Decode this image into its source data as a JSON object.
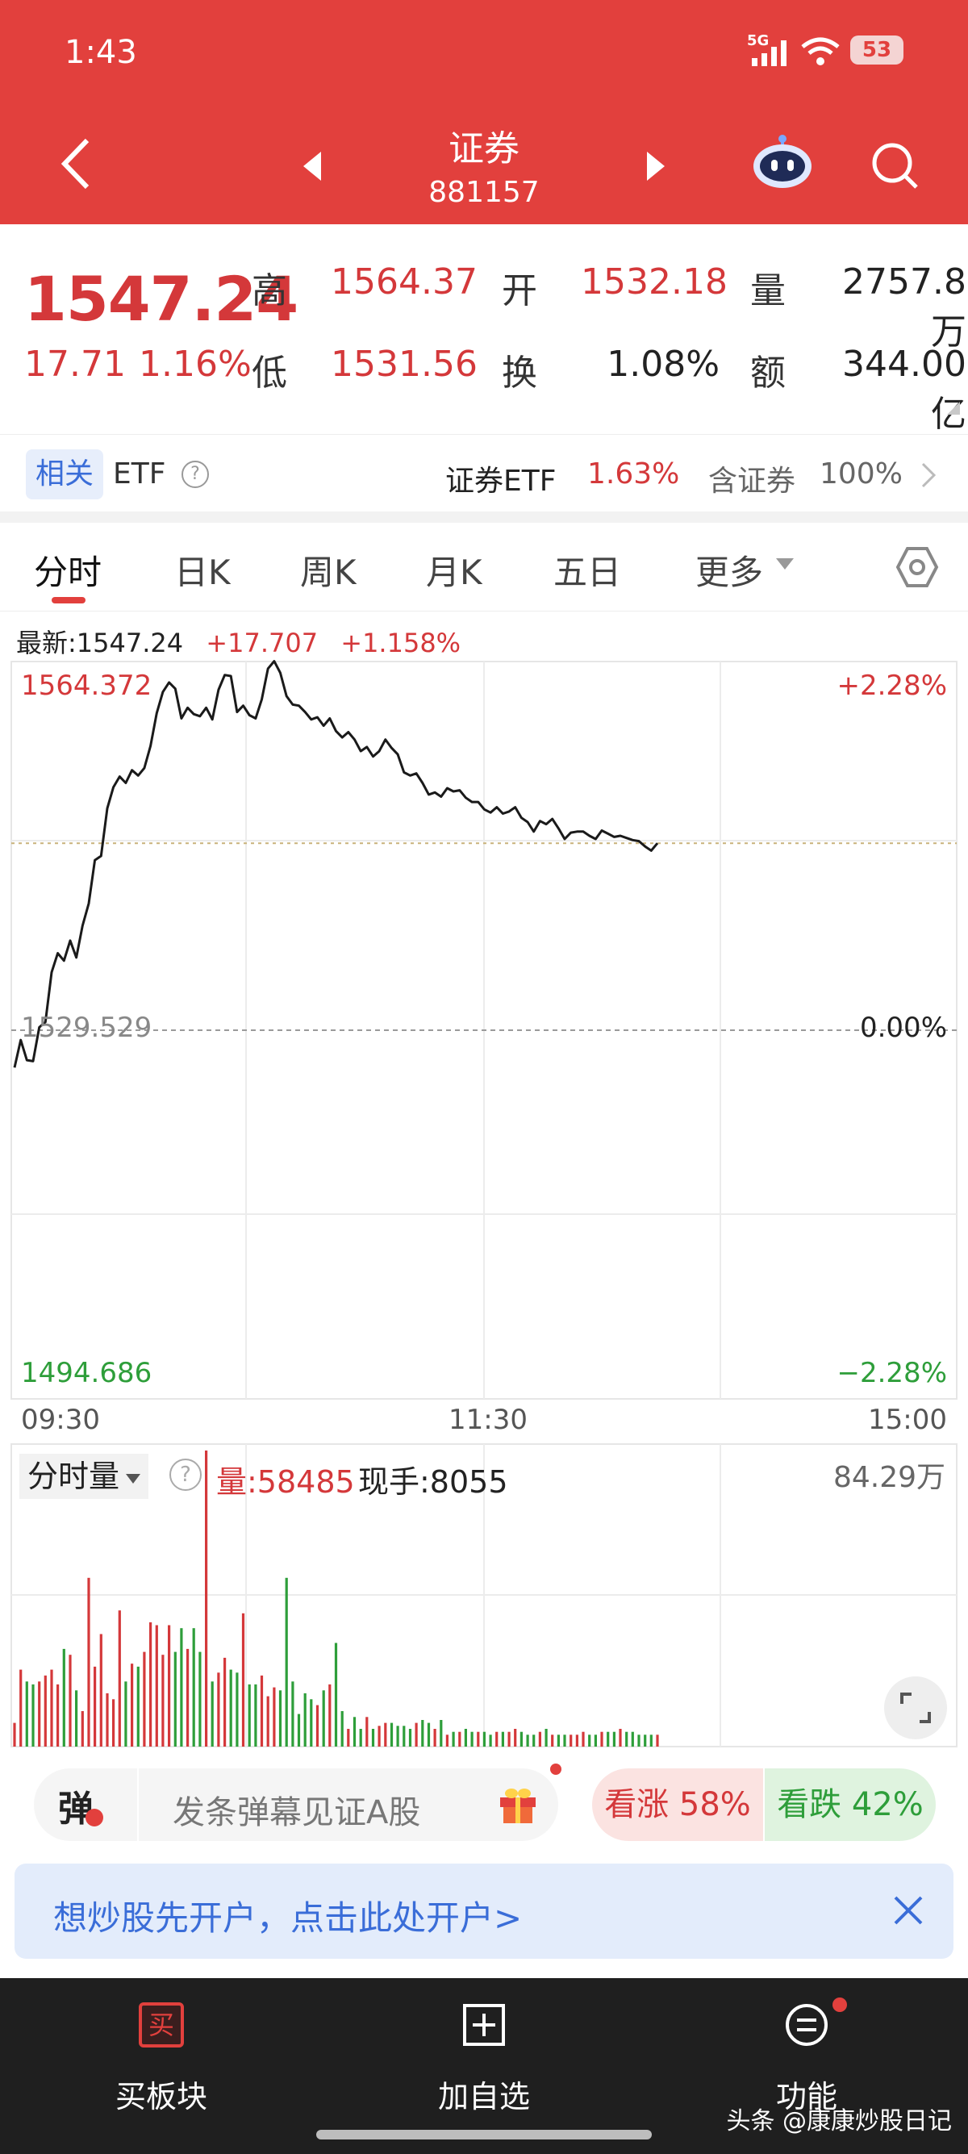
{
  "status_bar": {
    "time": "1:43",
    "network": "5G",
    "battery": "53"
  },
  "header": {
    "title": "证券",
    "code": "881157"
  },
  "quote": {
    "price": "1547.24",
    "change": "17.71",
    "change_pct": "1.16%",
    "high_label": "高",
    "high": "1564.37",
    "low_label": "低",
    "low": "1531.56",
    "open_label": "开",
    "open": "1532.18",
    "turnover_label": "换",
    "turnover": "1.08%",
    "volume_label": "量",
    "volume": "2757.8万",
    "amount_label": "额",
    "amount": "344.00亿"
  },
  "etf": {
    "tag": "相关",
    "label": "ETF",
    "help": "?",
    "name": "证券ETF",
    "pct": "1.63%",
    "contains_label": "含证券",
    "contains_value": "100%"
  },
  "tabs": [
    "分时",
    "日K",
    "周K",
    "月K",
    "五日",
    "更多"
  ],
  "intraday": {
    "latest_label": "最新:1547.24",
    "latest_change": "+17.707",
    "latest_pct": "+1.158%",
    "y_top": "1564.372",
    "y_mid": "1529.529",
    "y_bottom": "1494.686",
    "pct_top": "+2.28%",
    "pct_mid": "0.00%",
    "pct_bottom": "−2.28%",
    "time_start": "09:30",
    "time_mid": "11:30",
    "time_end": "15:00"
  },
  "volume_panel": {
    "selector": "分时量",
    "help": "?",
    "volume_text": "量:58485",
    "hand_text": "现手:8055",
    "max_label": "84.29万"
  },
  "danmu": {
    "icon_char": "弹",
    "placeholder": "发条弹幕见证A股"
  },
  "vote": {
    "up": "看涨 58%",
    "down": "看跌 42%"
  },
  "promo": {
    "text": "想炒股先开户，点击此处开户>"
  },
  "bottom_nav": [
    {
      "label": "买板块",
      "icon_char": "买"
    },
    {
      "label": "加自选"
    },
    {
      "label": "功能"
    }
  ],
  "watermark": "头条 @康康炒股日记",
  "colors": {
    "up": "#d4383a",
    "down": "#2e9e3a",
    "header": "#e2403d",
    "link": "#3a6dd8"
  },
  "chart_data": {
    "type": "line",
    "title": "",
    "xlabel": "",
    "ylabel": "",
    "x_range": [
      "09:30",
      "15:00"
    ],
    "ylim": [
      1494.686,
      1564.372
    ],
    "baseline": 1529.529,
    "series": [
      {
        "values": [
          1526.0,
          1528.6,
          1526.7,
          1526.6,
          1529.8,
          1530.3,
          1535.0,
          1536.8,
          1536.1,
          1538.0,
          1536.4,
          1539.4,
          1541.5,
          1545.6,
          1546.0,
          1550.5,
          1552.5,
          1553.5,
          1552.9,
          1554.1,
          1553.6,
          1554.3,
          1556.4,
          1559.5,
          1561.5,
          1562.4,
          1561.8,
          1559.0,
          1560.0,
          1559.4,
          1559.2,
          1560.0,
          1558.9,
          1561.7,
          1563.1,
          1563.0,
          1559.6,
          1560.2,
          1559.3,
          1559.0,
          1560.8,
          1563.7,
          1564.4,
          1563.3,
          1561.1,
          1560.3,
          1560.2,
          1559.6,
          1558.9,
          1559.1,
          1558.3,
          1559.0,
          1557.8,
          1557.2,
          1557.7,
          1557.0,
          1555.9,
          1556.3,
          1555.4,
          1555.9,
          1557.0,
          1556.2,
          1555.6,
          1553.9,
          1553.6,
          1553.8,
          1552.9,
          1551.8,
          1552.0,
          1551.6,
          1552.4,
          1552.1,
          1552.2,
          1551.5,
          1551.1,
          1551.1,
          1550.4,
          1550.1,
          1550.6,
          1550.0,
          1550.2,
          1550.6,
          1549.6,
          1549.2,
          1548.3,
          1549.3,
          1549.0,
          1549.5,
          1548.6,
          1547.6,
          1548.2,
          1548.3,
          1548.3,
          1547.9,
          1547.6,
          1548.4,
          1548.1,
          1547.8,
          1547.9,
          1547.7,
          1547.5,
          1547.4,
          1546.9,
          1546.5,
          1547.2
        ]
      }
    ],
    "volume_max": "84.29万",
    "volume_values": [
      8,
      26,
      22,
      21,
      22,
      24,
      26,
      21,
      33,
      31,
      19,
      12,
      57,
      27,
      38,
      18,
      16,
      46,
      22,
      28,
      27,
      32,
      42,
      41,
      31,
      41,
      32,
      40,
      33,
      40,
      32,
      100,
      22,
      25,
      30,
      26,
      25,
      45,
      21,
      21,
      24,
      17,
      20,
      19,
      57,
      22,
      11,
      18,
      16,
      14,
      19,
      21,
      35,
      12,
      6,
      10,
      6,
      10,
      6,
      7,
      8,
      8,
      7,
      7,
      6,
      8,
      9,
      8,
      6,
      9,
      4,
      5,
      5,
      6,
      5,
      5,
      5,
      4,
      5,
      5,
      5,
      6,
      5,
      4,
      4,
      5,
      6,
      4,
      4,
      4,
      4,
      4,
      5,
      4,
      4,
      5,
      5,
      5,
      6,
      5,
      5,
      4,
      4,
      4,
      4
    ],
    "volume_unit": "% of max"
  }
}
